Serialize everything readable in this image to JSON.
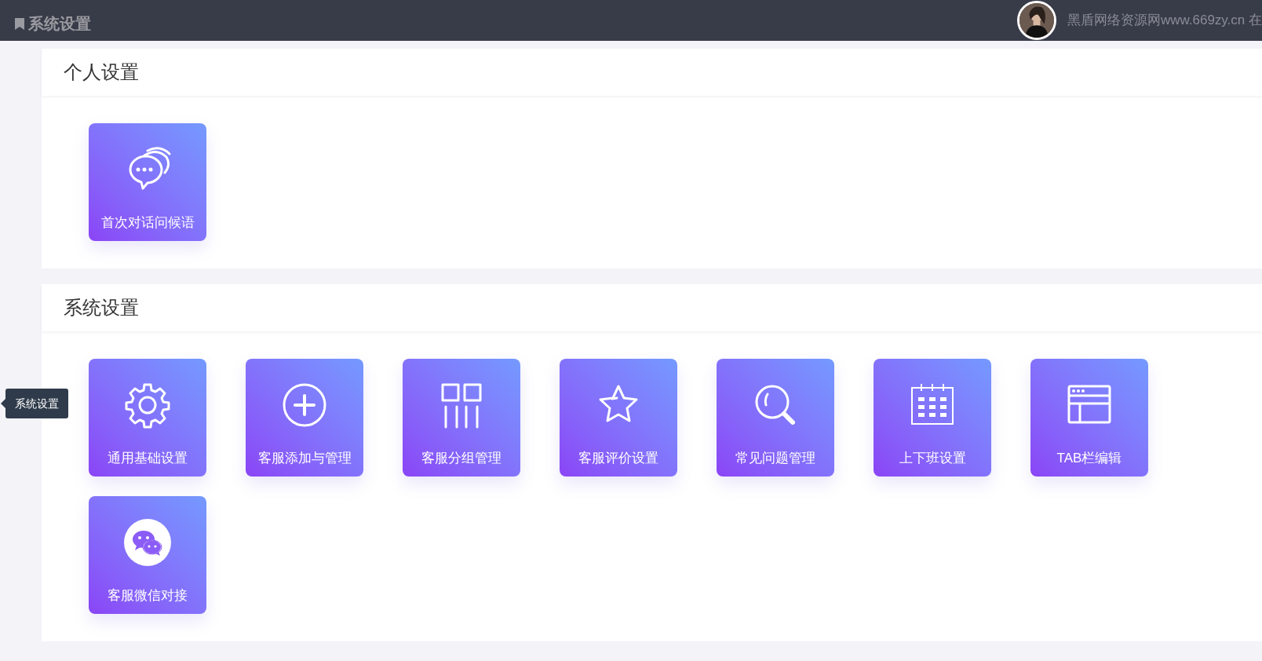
{
  "header": {
    "title": "系统设置",
    "user_name": "黑盾网络资源网www.669zy.cn 在"
  },
  "sections": [
    {
      "title": "个人设置",
      "tiles": [
        {
          "label": "首次对话问候语"
        }
      ]
    },
    {
      "title": "系统设置",
      "tiles": [
        {
          "label": "通用基础设置"
        },
        {
          "label": "客服添加与管理"
        },
        {
          "label": "客服分组管理"
        },
        {
          "label": "客服评价设置"
        },
        {
          "label": "常见问题管理"
        },
        {
          "label": "上下班设置"
        },
        {
          "label": "TAB栏编辑"
        },
        {
          "label": "客服微信对接"
        }
      ]
    }
  ],
  "tooltip": "系统设置"
}
